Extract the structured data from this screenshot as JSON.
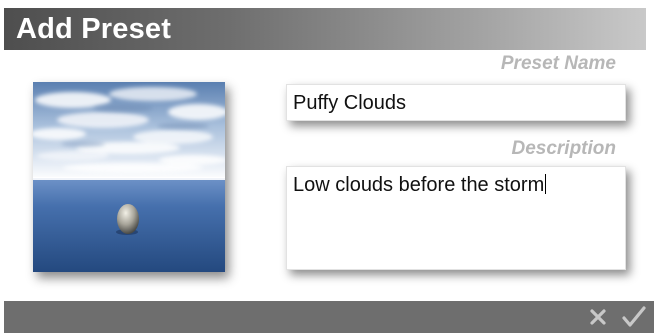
{
  "dialog": {
    "title": "Add Preset"
  },
  "fields": {
    "preset_name_label": "Preset Name",
    "preset_name_value": "Puffy Clouds",
    "description_label": "Description",
    "description_value": "Low clouds before the storm"
  },
  "preview": {
    "icon": "sky-preview-thumbnail"
  },
  "actions": {
    "cancel_icon": "close-icon",
    "confirm_icon": "checkmark-icon"
  },
  "colors": {
    "title_bar_dark": "#4e4e4e",
    "title_bar_light": "#c9c9c9",
    "label_gray": "#b7b7b7",
    "bottom_bar": "#6e6e6e",
    "button_glyph": "#c8c8c8"
  }
}
